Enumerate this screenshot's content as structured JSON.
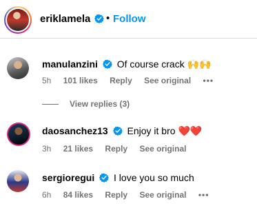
{
  "header": {
    "username": "eriklamela",
    "separator": "•",
    "follow_label": "Follow"
  },
  "comments": [
    {
      "username": "manulanzini",
      "text": "Of course crack",
      "emoji": "🙌🙌",
      "time": "5h",
      "likes": "101 likes",
      "reply_label": "Reply",
      "see_original_label": "See original",
      "more": "•••"
    },
    {
      "username": "daosanchez13",
      "text": "Enjoy it bro",
      "emoji": "❤️❤️",
      "time": "3h",
      "likes": "21 likes",
      "reply_label": "Reply",
      "see_original_label": "See original"
    },
    {
      "username": "sergioregui",
      "text": "I love you so much",
      "time": "6h",
      "likes": "84 likes",
      "reply_label": "Reply",
      "see_original_label": "See original",
      "more": "•••"
    }
  ],
  "view_replies_label": "View replies (3)",
  "colors": {
    "accent": "#0095f6",
    "verified": "#0095f6",
    "meta_text": "#737373",
    "divider": "#dbdbdb"
  }
}
